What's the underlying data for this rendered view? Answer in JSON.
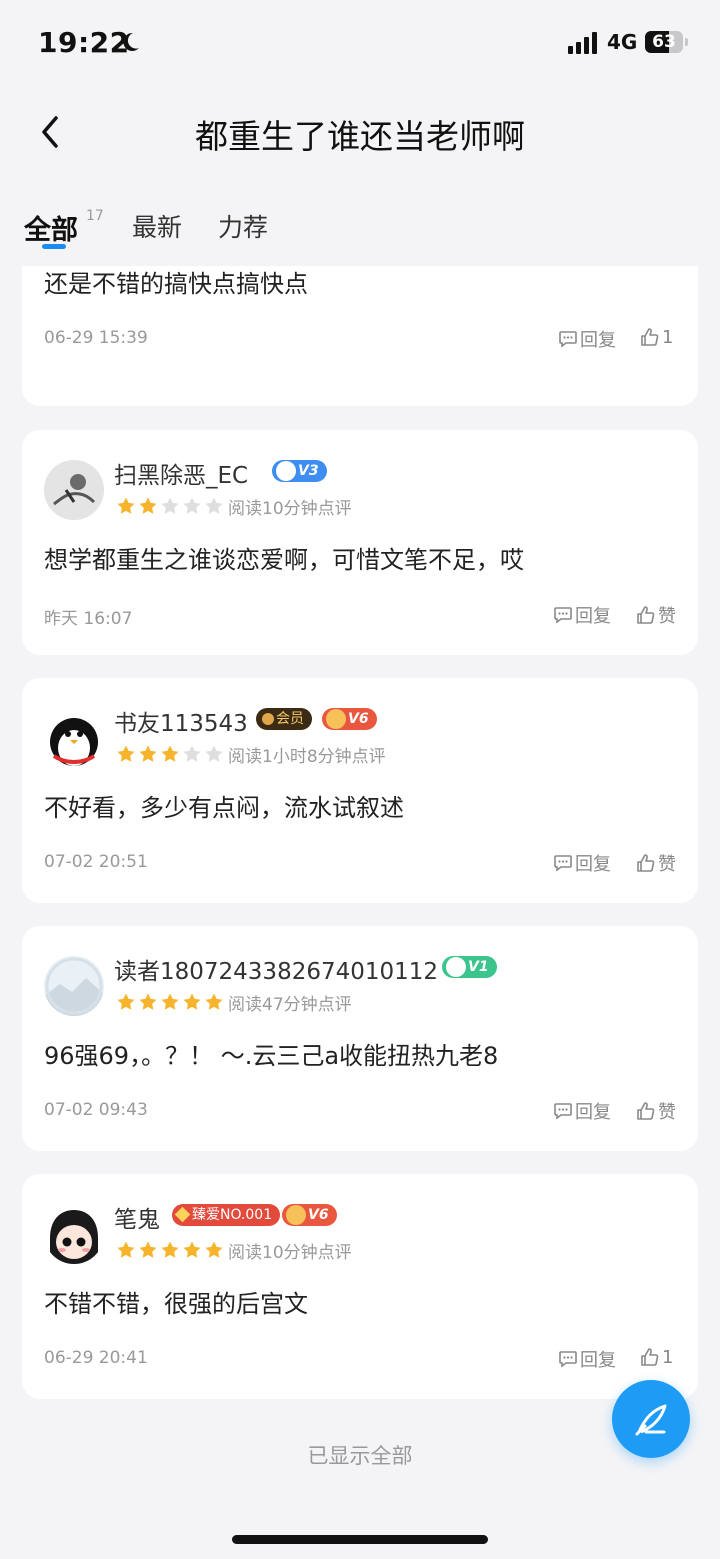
{
  "status_bar": {
    "time": "19:22",
    "network": "4G",
    "battery": "63",
    "battery_level": 0.63
  },
  "header": {
    "title": "都重生了谁还当老师啊"
  },
  "tabs": [
    {
      "label": "全部",
      "count": "17"
    },
    {
      "label": "最新"
    },
    {
      "label": "力荐"
    }
  ],
  "reviews": [
    {
      "content": "还是不错的搞快点搞快点",
      "date": "06-29 15:39",
      "reply_label": "回复",
      "like_label": "1"
    },
    {
      "username": "扫黑除恶_EC",
      "level": "V3",
      "rating": 2,
      "read_time": "阅读10分钟点评",
      "content": "想学都重生之谁谈恋爱啊，可惜文笔不足，哎",
      "date": "昨天 16:07",
      "reply_label": "回复",
      "like_label": "赞"
    },
    {
      "username": "书友113543",
      "member_badge": "会员",
      "level": "V6",
      "rating": 3,
      "read_time": "阅读1小时8分钟点评",
      "content": "不好看，多少有点闷，流水试叙述",
      "date": "07-02 20:51",
      "reply_label": "回复",
      "like_label": "赞"
    },
    {
      "username": "读者1807243382674010112",
      "level": "V1",
      "rating": 5,
      "read_time": "阅读47分钟点评",
      "content": "96强69，。？！ ～.云三己a收能扭热九老8",
      "date": "07-02 09:43",
      "reply_label": "回复",
      "like_label": "赞"
    },
    {
      "username": "笔鬼",
      "fan_badge": "臻爱NO.001",
      "level": "V6",
      "rating": 5,
      "read_time": "阅读10分钟点评",
      "content": "不错不错，很强的后宫文",
      "date": "06-29 20:41",
      "reply_label": "回复",
      "like_label": "1"
    }
  ],
  "footer": {
    "end_text": "已显示全部"
  },
  "colors": {
    "accent": "#1d9bf5",
    "star_on": "#f7b32b",
    "star_off": "#dedede"
  },
  "icons": {
    "fab": "pen-icon",
    "reply": "comment-icon",
    "like": "thumbs-up-icon"
  }
}
